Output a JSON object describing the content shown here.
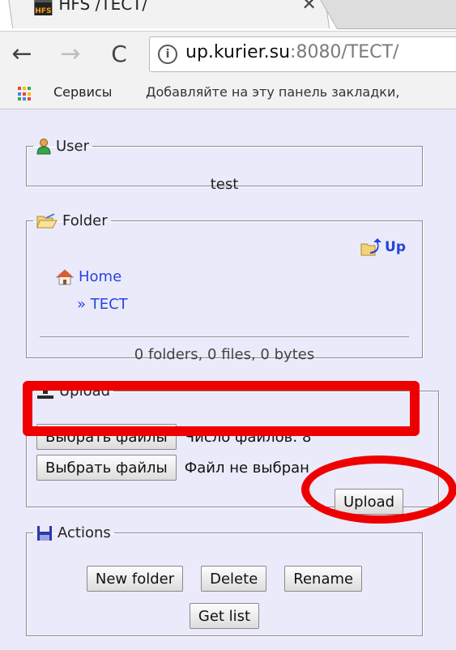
{
  "browser": {
    "tab": {
      "title": "HFS /ТЕСТ/",
      "favicon_text": "HFS",
      "close_glyph": "✕"
    },
    "nav": {
      "back_glyph": "←",
      "forward_glyph": "→",
      "reload_glyph": "C"
    },
    "omnibox": {
      "info_glyph": "i",
      "url_host": "up.kurier.su",
      "url_rest": ":8080/ТЕСТ/"
    },
    "bookmarks": {
      "apps_label": "Сервисы",
      "hint": "Добавляйте на эту панель закладки,"
    },
    "colors": {
      "apps_icon": [
        "#ea4335",
        "#fbbc05",
        "#34a853",
        "#4285f4",
        "#ea4335",
        "#fbbc05",
        "#34a853",
        "#4285f4",
        "#ea4335"
      ]
    }
  },
  "hfs": {
    "user": {
      "legend": "User",
      "name": "test"
    },
    "folder": {
      "legend": "Folder",
      "up_label": "Up",
      "home_label": "Home",
      "crumb_label": "» ТЕСТ",
      "stats": "0 folders, 0 files, 0 bytes"
    },
    "upload": {
      "legend": "Upload",
      "choose_label_1": "Выбрать файлы",
      "status_1": "Число файлов: 8",
      "choose_label_2": "Выбрать файлы",
      "status_2": "Файл не выбран",
      "upload_label": "Upload"
    },
    "actions": {
      "legend": "Actions",
      "new_folder": "New folder",
      "delete": "Delete",
      "rename": "Rename",
      "get_list": "Get list"
    }
  },
  "annotations": {
    "color": "#ee0000"
  }
}
